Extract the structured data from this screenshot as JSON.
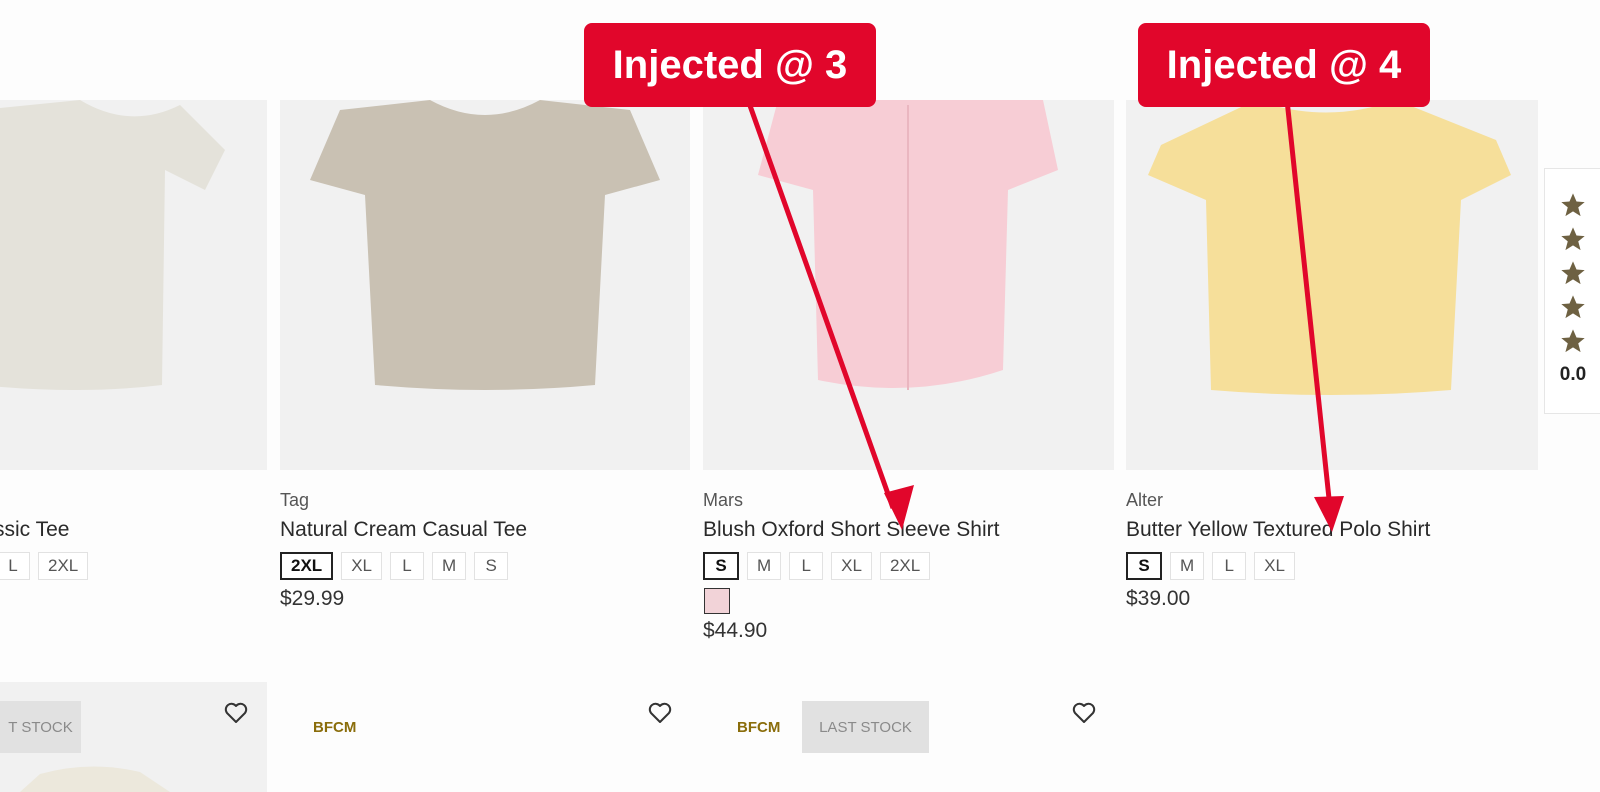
{
  "products": [
    {
      "brand": "",
      "title": "ssic Tee",
      "sizes": [
        "L",
        "2XL"
      ],
      "selected": "",
      "price": ""
    },
    {
      "brand": "Tag",
      "title": "Natural Cream Casual Tee",
      "sizes": [
        "2XL",
        "XL",
        "L",
        "M",
        "S"
      ],
      "selected": "2XL",
      "price": "$29.99"
    },
    {
      "brand": "Mars",
      "title": "Blush Oxford Short Sleeve Shirt",
      "sizes": [
        "S",
        "M",
        "L",
        "XL",
        "2XL"
      ],
      "selected": "S",
      "price": "$44.90",
      "swatch_color": "#f2d3d8"
    },
    {
      "brand": "Alter",
      "title": "Butter Yellow Textured Polo Shirt",
      "sizes": [
        "S",
        "M",
        "L",
        "XL"
      ],
      "selected": "S",
      "price": "$39.00"
    }
  ],
  "row2": {
    "card1_badge": "T STOCK",
    "card2_badge": "BFCM",
    "card3_badge": "BFCM",
    "card3_stock": "LAST STOCK"
  },
  "callouts": [
    {
      "label": "Injected @ 3"
    },
    {
      "label": "Injected @ 4"
    }
  ],
  "rating": {
    "value": "0.0",
    "stars": 5
  },
  "colors": {
    "accent_red": "#e1062b",
    "star": "#6e6142",
    "bfcm": "#8a6d0b"
  },
  "icons": [
    "heart-icon",
    "star-icon"
  ]
}
